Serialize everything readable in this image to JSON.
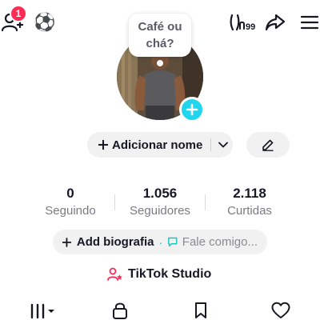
{
  "header": {
    "notification_count": "1",
    "emoji": "⚽",
    "icons": [
      "add-friend-icon",
      "soccer-ball-icon",
      "creator-tools-icon",
      "share-icon",
      "menu-icon"
    ]
  },
  "profile": {
    "note_text": "Café ou chá?",
    "add_name_label": "Adicionar nome",
    "edit_icon": "pencil-icon"
  },
  "stats": [
    {
      "value": "0",
      "label": "Seguindo"
    },
    {
      "value": "1.056",
      "label": "Seguidores"
    },
    {
      "value": "2.118",
      "label": "Curtidas"
    }
  ],
  "bio": {
    "add_label": "Add biografia",
    "separator": "·",
    "hint": "Fale comigo..."
  },
  "studio": {
    "label": "TikTok Studio"
  },
  "tabs": [
    "videos-grid-icon",
    "lock-icon",
    "bookmark-icon",
    "heart-icon"
  ],
  "colors": {
    "badge": "#fe2c55",
    "plus_button": "#20d5ec",
    "accent_teal": "#1fc4bd",
    "studio_icon": "#fe2c55"
  }
}
